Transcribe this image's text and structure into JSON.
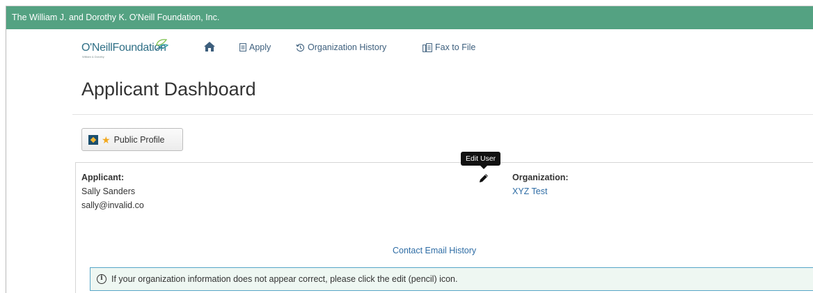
{
  "topbar": {
    "title": "The William J. and Dorothy K. O'Neill Foundation, Inc."
  },
  "nav": {
    "logo_text_1": "O'Neill",
    "logo_text_2": "Foundation",
    "logo_tagline": "William & Dorothy",
    "home_icon": "home-icon",
    "apply_label": "Apply",
    "history_label": "Organization History",
    "fax_label": "Fax to File"
  },
  "page": {
    "title": "Applicant Dashboard"
  },
  "profile_button": {
    "label": "Public Profile"
  },
  "applicant": {
    "heading": "Applicant:",
    "name": "Sally Sanders",
    "email": "sally@invalid.co"
  },
  "edit_user": {
    "tooltip": "Edit User",
    "icon": "pencil-icon"
  },
  "organization": {
    "heading": "Organization:",
    "name": "XYZ Test"
  },
  "contact_history": {
    "label": "Contact Email History"
  },
  "alert": {
    "icon": "info-icon",
    "text": "If your organization information does not appear correct, please click the edit (pencil) icon."
  },
  "colors": {
    "topbar": "#54a282",
    "link": "#2f6da5",
    "alert_border": "#57a6c7",
    "alert_bg": "#eef7f2"
  }
}
